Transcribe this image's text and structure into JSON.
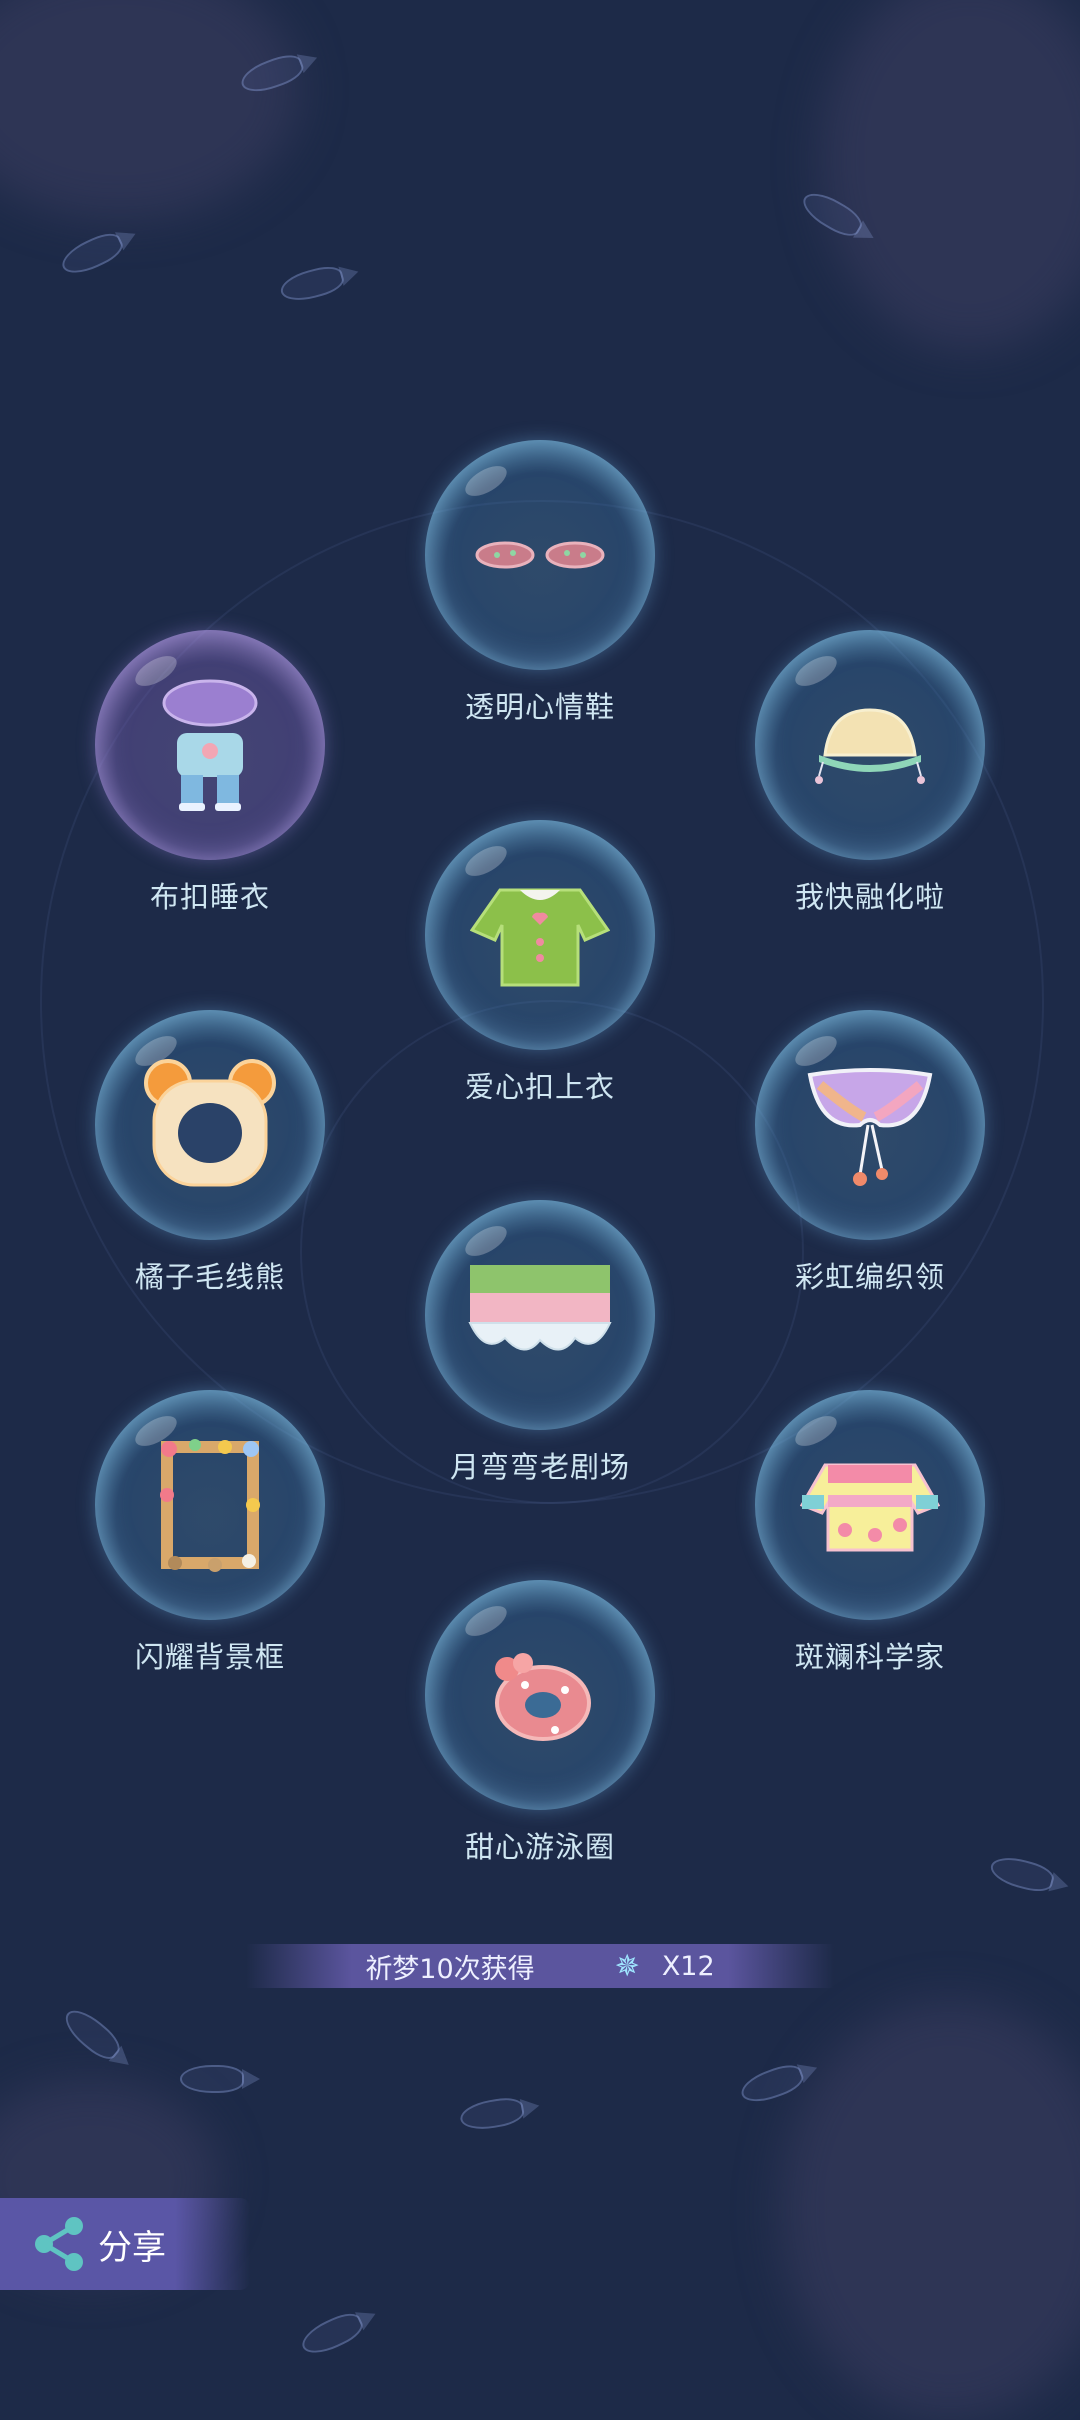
{
  "items": {
    "shoes": {
      "label": "透明心情鞋"
    },
    "pajamas": {
      "label": "布扣睡衣"
    },
    "hat": {
      "label": "我快融化啦"
    },
    "top": {
      "label": "爱心扣上衣"
    },
    "bear": {
      "label": "橘子毛线熊"
    },
    "collar": {
      "label": "彩虹编织领"
    },
    "stage": {
      "label": "月弯弯老剧场"
    },
    "frame": {
      "label": "闪耀背景框"
    },
    "sci": {
      "label": "斑斓科学家"
    },
    "ring": {
      "label": "甜心游泳圈"
    }
  },
  "banner": {
    "text": "祈梦10次获得",
    "count": "X12",
    "icon": "snowflake-star-icon"
  },
  "share": {
    "label": "分享",
    "icon": "share-icon"
  },
  "colors": {
    "background": "#1d2a48",
    "label": "#cfe6f2",
    "banner": "#5b559e"
  }
}
